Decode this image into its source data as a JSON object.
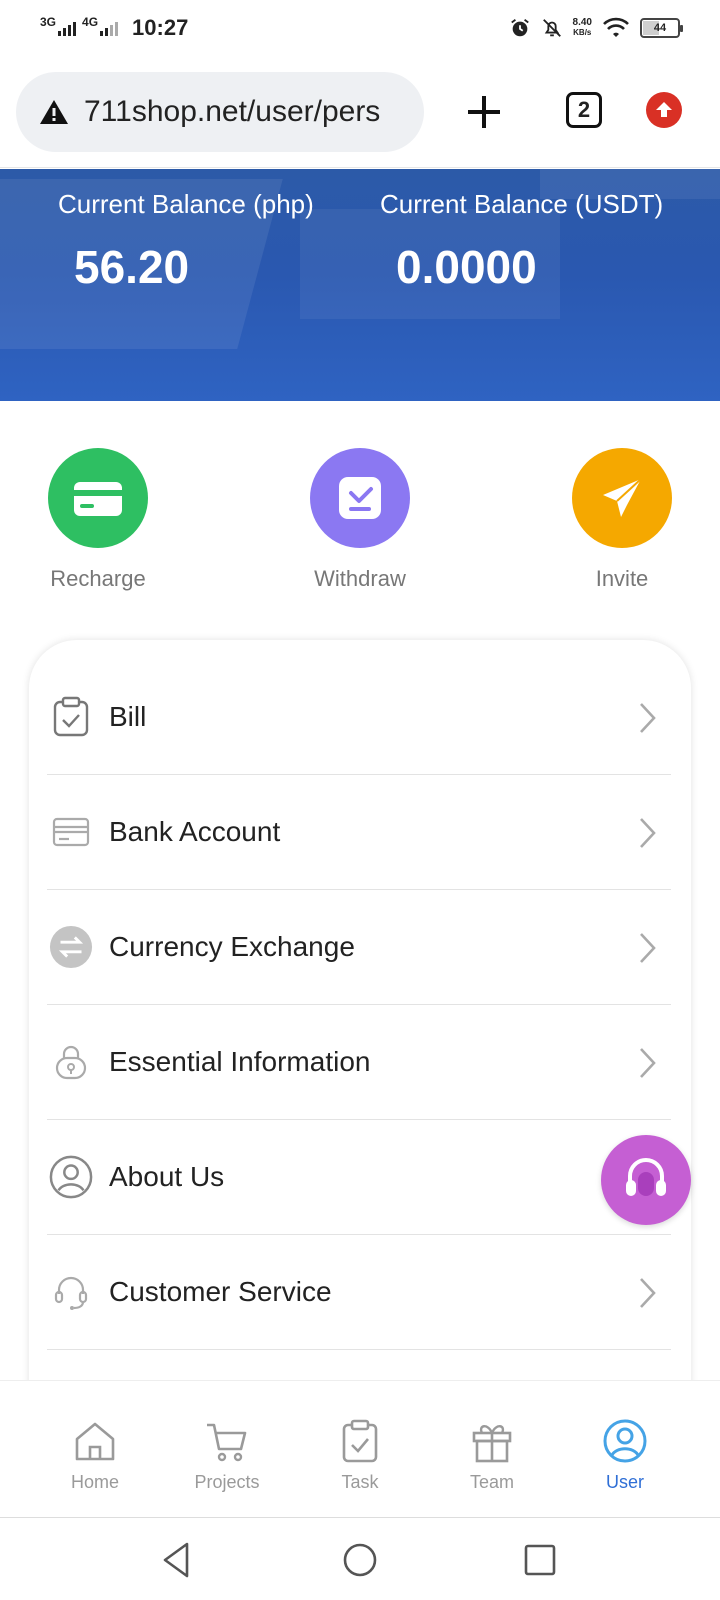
{
  "status_bar": {
    "network1": "3G",
    "network2": "4G",
    "time": "10:27",
    "speed_value": "8.40",
    "speed_unit": "KB/s",
    "battery": "44"
  },
  "browser": {
    "url": "711shop.net/user/pers",
    "tab_count": "2"
  },
  "balance": {
    "php_label": "Current Balance (php)",
    "php_value": "56.20",
    "usdt_label": "Current Balance (USDT)",
    "usdt_value": "0.0000"
  },
  "actions": [
    {
      "label": "Recharge",
      "icon": "card-icon",
      "color": "#2ebf62"
    },
    {
      "label": "Withdraw",
      "icon": "withdraw-icon",
      "color": "#8b78f2"
    },
    {
      "label": "Invite",
      "icon": "paper-plane-icon",
      "color": "#f5a800"
    }
  ],
  "menu": {
    "items": [
      {
        "label": "Bill",
        "icon": "clipboard-icon"
      },
      {
        "label": "Bank Account",
        "icon": "bank-card-icon"
      },
      {
        "label": "Currency Exchange",
        "icon": "exchange-icon"
      },
      {
        "label": "Essential Information",
        "icon": "lock-icon"
      },
      {
        "label": "About Us",
        "icon": "user-circle-icon"
      },
      {
        "label": "Customer Service",
        "icon": "headset-icon"
      }
    ]
  },
  "bottom_nav": {
    "items": [
      {
        "label": "Home",
        "icon": "home-icon"
      },
      {
        "label": "Projects",
        "icon": "cart-icon"
      },
      {
        "label": "Task",
        "icon": "clipboard-check-icon"
      },
      {
        "label": "Team",
        "icon": "gift-icon"
      },
      {
        "label": "User",
        "icon": "user-icon",
        "active": true
      }
    ],
    "active_color": "#2f6fd6"
  }
}
